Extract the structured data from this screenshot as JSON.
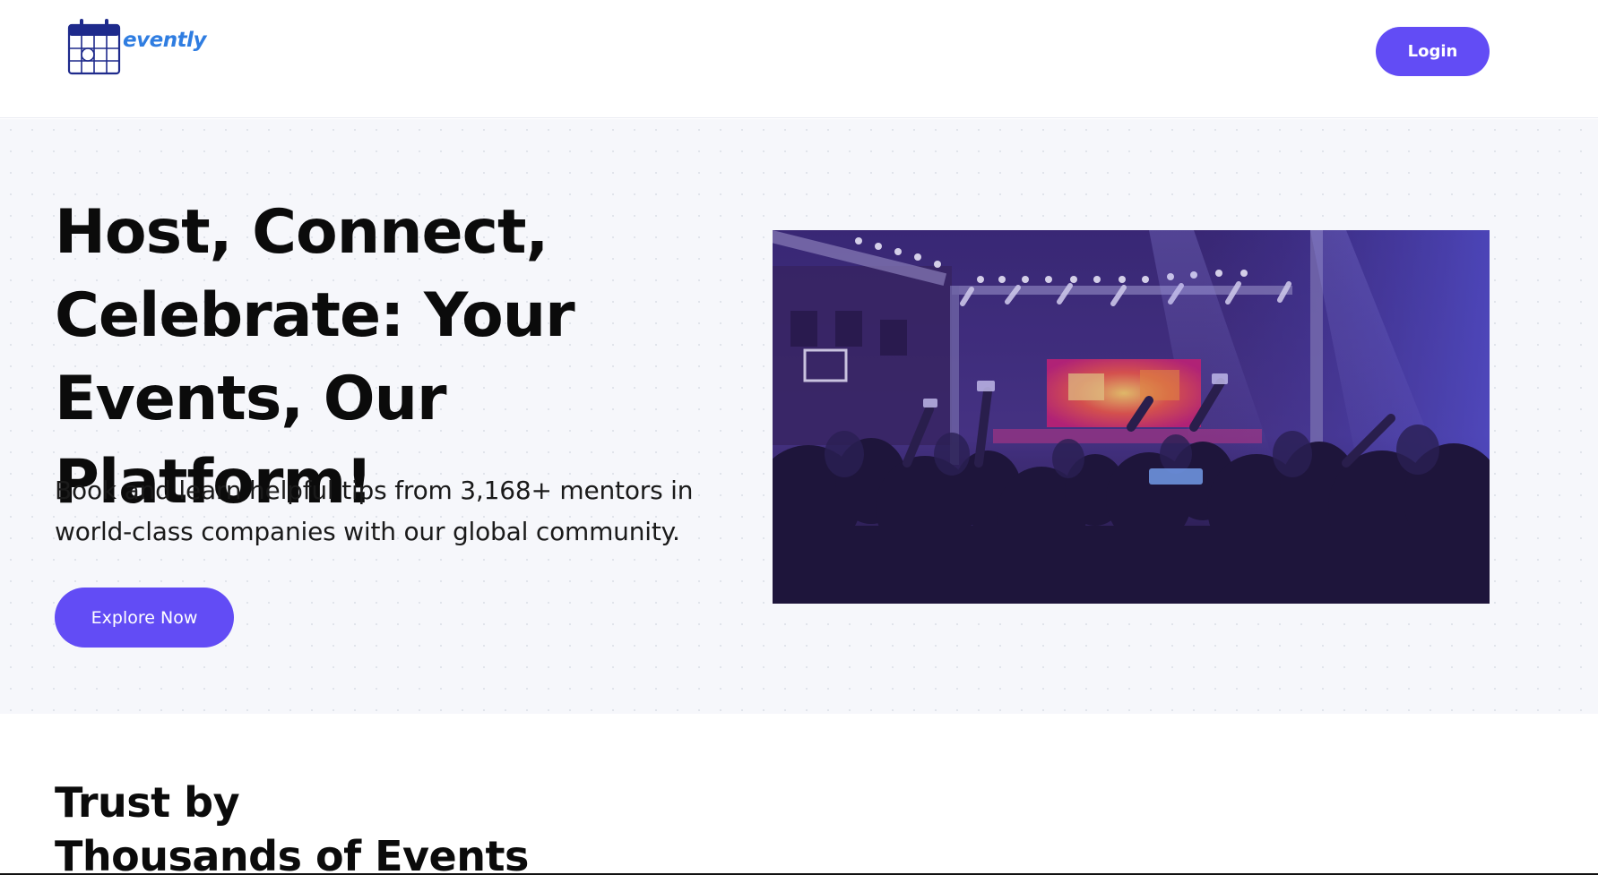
{
  "brand": {
    "name": "evently",
    "primary_color": "#624cf5",
    "logo_text_color": "#2f7de1",
    "logo_icon": "calendar-icon"
  },
  "header": {
    "login_label": "Login"
  },
  "hero": {
    "title": "Host, Connect,\nCelebrate: Your\nEvents, Our Platform!",
    "subtitle": "Book and learn helpful tips from 3,168+ mentors in\nworld-class companies with our global community.",
    "cta_label": "Explore Now",
    "image": "concert-crowd-photo"
  },
  "trust": {
    "title": "Trust by\nThousands of Events"
  }
}
